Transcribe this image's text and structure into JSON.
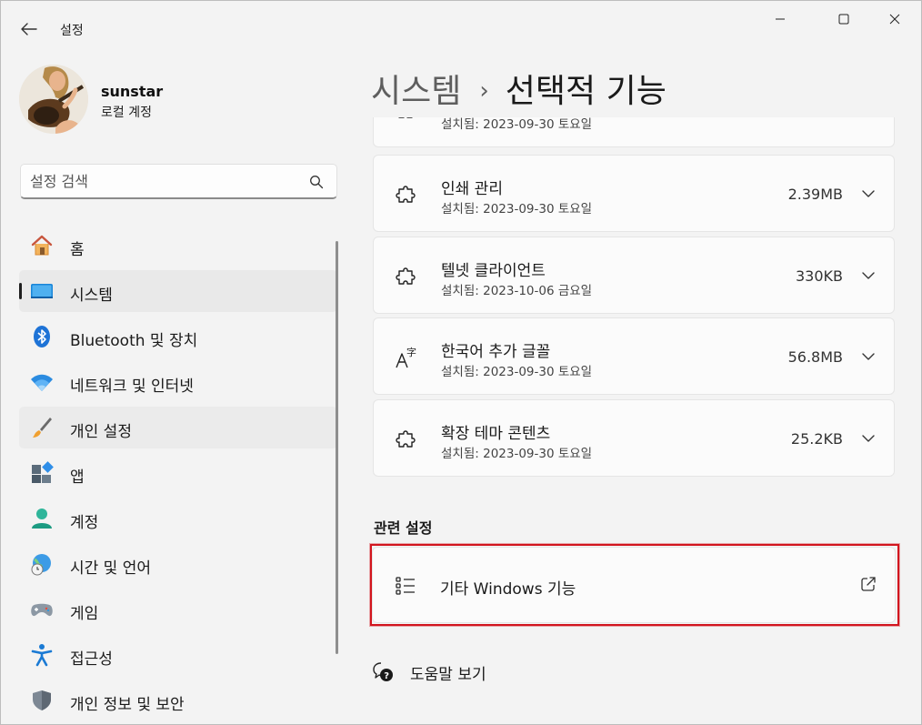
{
  "window": {
    "app_title": "설정"
  },
  "profile": {
    "name": "sunstar",
    "account_type": "로컬 계정"
  },
  "search": {
    "placeholder": "설정 검색"
  },
  "nav": {
    "items": [
      {
        "label": "홈",
        "icon": "home-icon"
      },
      {
        "label": "시스템",
        "icon": "system-icon"
      },
      {
        "label": "Bluetooth 및 장치",
        "icon": "bluetooth-icon"
      },
      {
        "label": "네트워크 및 인터넷",
        "icon": "wifi-icon"
      },
      {
        "label": "개인 설정",
        "icon": "brush-icon"
      },
      {
        "label": "앱",
        "icon": "apps-icon"
      },
      {
        "label": "계정",
        "icon": "account-icon"
      },
      {
        "label": "시간 및 언어",
        "icon": "globe-clock-icon"
      },
      {
        "label": "게임",
        "icon": "gamepad-icon"
      },
      {
        "label": "접근성",
        "icon": "accessibility-icon"
      },
      {
        "label": "개인 정보 및 보안",
        "icon": "shield-icon"
      }
    ],
    "active_index": 1
  },
  "header": {
    "parent": "시스템",
    "separator": "›",
    "current": "선택적 기능"
  },
  "features": {
    "partial_top": {
      "date": "설치됨: 2023-09-30 토요일"
    },
    "items": [
      {
        "name": "인쇄 관리",
        "date": "설치됨: 2023-09-30 토요일",
        "size": "2.39MB",
        "icon": "puzzle-icon"
      },
      {
        "name": "텔넷 클라이언트",
        "date": "설치됨: 2023-10-06 금요일",
        "size": "330KB",
        "icon": "puzzle-icon"
      },
      {
        "name": "한국어 추가 글꼴",
        "date": "설치됨: 2023-09-30 토요일",
        "size": "56.8MB",
        "icon": "font-icon"
      },
      {
        "name": "확장 테마 콘텐츠",
        "date": "설치됨: 2023-09-30 토요일",
        "size": "25.2KB",
        "icon": "puzzle-icon"
      }
    ]
  },
  "related": {
    "heading": "관련 설정",
    "item_label": "기타 Windows 기능",
    "highlight_color": "#d2151e"
  },
  "help": {
    "label": "도움말 보기"
  },
  "colors": {
    "accent": "#0067c0",
    "background": "#f3f3f3",
    "card": "#fbfbfb"
  }
}
